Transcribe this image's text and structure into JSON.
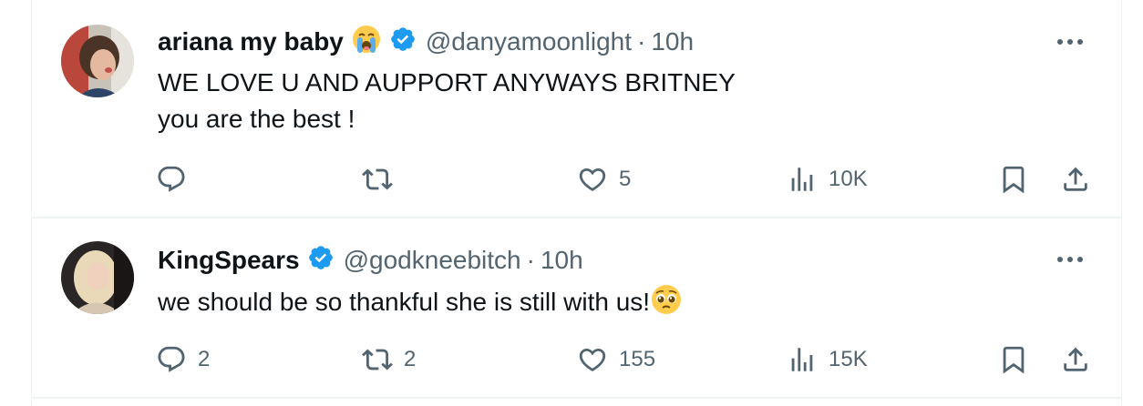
{
  "tweets": [
    {
      "display_name": "ariana my baby",
      "name_emoji": "crying-face",
      "verified": true,
      "handle": "@danyamoonlight",
      "separator": "·",
      "time": "10h",
      "lines": [
        "WE LOVE U AND AUPPORT ANYWAYS BRITNEY",
        "you are the best !"
      ],
      "replies": "",
      "retweets": "",
      "likes": "5",
      "views": "10K"
    },
    {
      "display_name": "KingSpears",
      "verified": true,
      "handle": "@godkneebitch",
      "separator": "·",
      "time": "10h",
      "lines": [
        "we should be so thankful she is still with us!"
      ],
      "text_emoji": "pleading-face",
      "replies": "2",
      "retweets": "2",
      "likes": "155",
      "views": "15K"
    }
  ],
  "colors": {
    "text": "#0f1419",
    "secondary": "#536471",
    "verified_blue": "#1d9bf0",
    "divider": "#eff3f4"
  },
  "icons": [
    "verified-badge-icon",
    "more-icon",
    "reply-icon",
    "retweet-icon",
    "like-icon",
    "views-icon",
    "bookmark-icon",
    "share-icon"
  ]
}
